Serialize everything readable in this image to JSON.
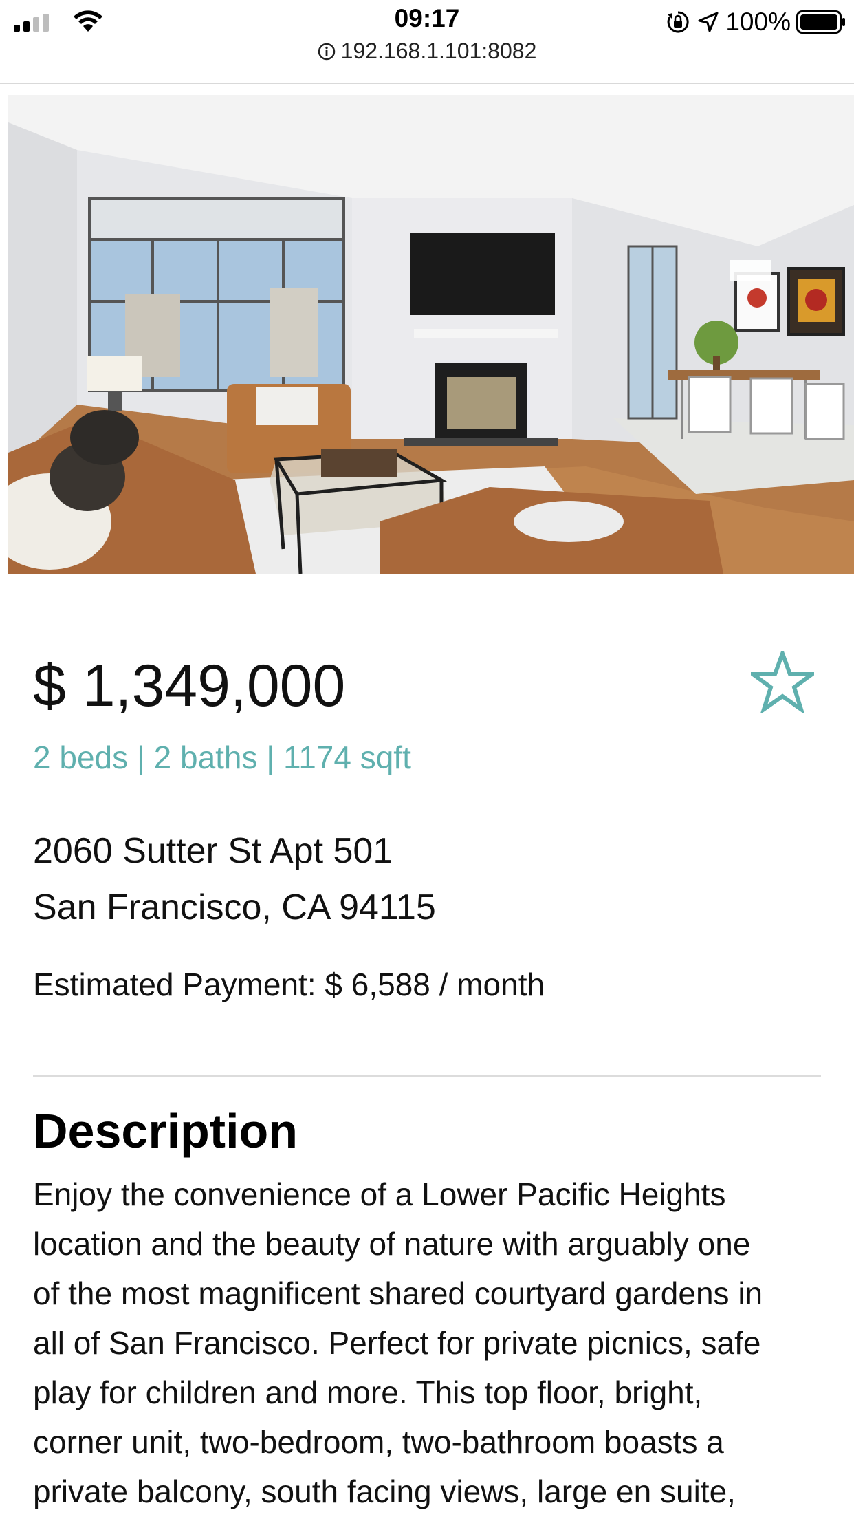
{
  "status_bar": {
    "time": "09:17",
    "url": "192.168.1.101:8082",
    "battery": "100%",
    "icons": [
      "signal-icon",
      "wifi-icon",
      "info-icon",
      "orientation-lock-icon",
      "location-icon",
      "battery-icon"
    ]
  },
  "listing": {
    "photo_icon": "living-room-photo",
    "price": "$ 1,349,000",
    "specs": "2 beds | 2 baths | 1174 sqft",
    "address_line1": "2060 Sutter St Apt 501",
    "address_line2": "San Francisco, CA 94115",
    "payment_label": "Estimated Payment:",
    "payment_value": "$ 6,588 / month",
    "favorite_icon": "star-outline-icon"
  },
  "description": {
    "heading": "Description",
    "lines": [
      "Enjoy the convenience of a Lower Pacific Heights",
      "location and the beauty of nature with arguably one",
      "of the most magnificent shared courtyard gardens in",
      "all of San Francisco. Perfect for private picnics, safe",
      "play for children and more. This top floor, bright,",
      "corner unit, two-bedroom, two-bathroom boasts a",
      "private balcony, south facing views, large en suite,"
    ]
  },
  "colors": {
    "accent": "#5fb0ae",
    "text": "#111111",
    "divider": "#dcdcdc"
  }
}
